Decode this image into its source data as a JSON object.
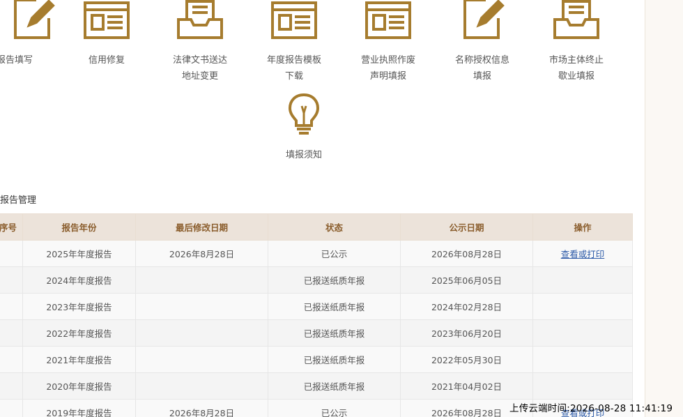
{
  "accent_color": "#a67c2e",
  "tiles": [
    {
      "icon": "edit-document-icon",
      "line1": "度报告填写",
      "line2": ""
    },
    {
      "icon": "browser-window-icon",
      "line1": "信用修复",
      "line2": ""
    },
    {
      "icon": "document-tray-icon",
      "line1": "法律文书送达",
      "line2": "地址变更"
    },
    {
      "icon": "browser-window-icon",
      "line1": "年度报告模板",
      "line2": "下载"
    },
    {
      "icon": "browser-window-icon",
      "line1": "营业执照作废",
      "line2": "声明填报"
    },
    {
      "icon": "edit-document-icon",
      "line1": "名称授权信息",
      "line2": "填报"
    },
    {
      "icon": "document-tray-icon",
      "line1": "市场主体终止",
      "line2": "歇业填报"
    },
    {
      "icon": "lightbulb-icon",
      "line1": "填报须知",
      "line2": ""
    }
  ],
  "section_title": "报告管理",
  "table": {
    "headers": [
      "序号",
      "报告年份",
      "最后修改日期",
      "状态",
      "公示日期",
      "操作"
    ],
    "rows": [
      {
        "seq": "",
        "year": "2025年年度报告",
        "modified": "2026年8月28日",
        "status": "已公示",
        "published": "2026年08月28日",
        "action": "查看或打印"
      },
      {
        "seq": "",
        "year": "2024年年度报告",
        "modified": "",
        "status": "已报送纸质年报",
        "published": "2025年06月05日",
        "action": ""
      },
      {
        "seq": "",
        "year": "2023年年度报告",
        "modified": "",
        "status": "已报送纸质年报",
        "published": "2024年02月28日",
        "action": ""
      },
      {
        "seq": "",
        "year": "2022年年度报告",
        "modified": "",
        "status": "已报送纸质年报",
        "published": "2023年06月20日",
        "action": ""
      },
      {
        "seq": "",
        "year": "2021年年度报告",
        "modified": "",
        "status": "已报送纸质年报",
        "published": "2022年05月30日",
        "action": ""
      },
      {
        "seq": "",
        "year": "2020年年度报告",
        "modified": "",
        "status": "已报送纸质年报",
        "published": "2021年04月02日",
        "action": ""
      },
      {
        "seq": "",
        "year": "2019年年度报告",
        "modified": "2026年8月28日",
        "status": "已公示",
        "published": "2026年08月28日",
        "action": "查看或打印"
      }
    ]
  },
  "watermark": "上传云端时间:2026-08-28 11:41:19"
}
